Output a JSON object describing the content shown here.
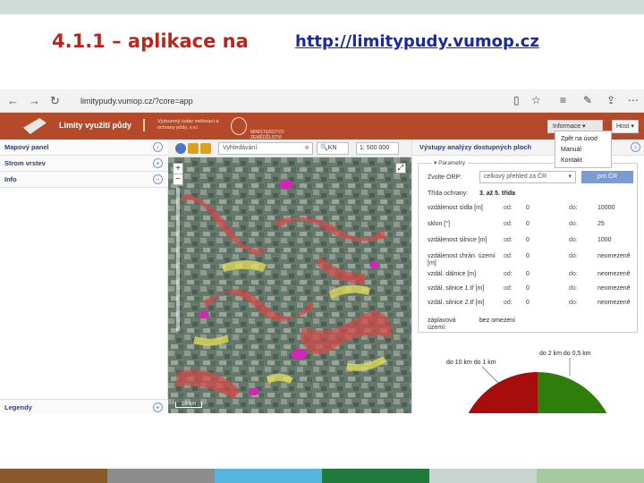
{
  "slide": {
    "title": "4.1.1 – aplikace na",
    "url": "http://limitypudy.vumop.cz"
  },
  "browser": {
    "address": "limitypudy.vumop.cz/?core=app"
  },
  "app": {
    "title": "Limity využití půdy",
    "institute": "Výzkumný ústav meliorací a ochrany půdy, v.v.i.",
    "ministry": "MINISTERSTVO ZEMĚDĚLSTVÍ",
    "info_button": "Informace",
    "host_button": "Host",
    "info_menu": [
      "Zpět na úvod",
      "Manuál",
      "Kontakt"
    ]
  },
  "sidebar": {
    "items": [
      {
        "label": "Mapový panel"
      },
      {
        "label": "Strom vrstev"
      },
      {
        "label": "Info"
      }
    ],
    "legend": "Legendy"
  },
  "toolbar": {
    "search_placeholder": "Vyhledávání",
    "kn_select": "KN",
    "scale": "1: 500 000"
  },
  "map": {
    "scalebar": "10 km"
  },
  "panel": {
    "title": "Výstupy analýzy dostupných ploch",
    "params_legend": "Parametry",
    "orp_label": "Zvolte ORP:",
    "orp_value": "celkový přehled za ČR",
    "orp_button": "pro ČR",
    "class_label": "Třída ochrany:",
    "class_value": "3. až 5. třída",
    "od_label": "od:",
    "do_label": "do:",
    "rows": [
      {
        "name": "vzdálenost sídla [m]",
        "from": "0",
        "to": "10000"
      },
      {
        "name": "sklon [°]",
        "from": "0",
        "to": "25"
      },
      {
        "name": "vzdálenost silnice [m]",
        "from": "0",
        "to": "1000"
      },
      {
        "name": "vzdálenost chrán. území [m]",
        "from": "0",
        "to": "neomezeně"
      },
      {
        "name": "vzdál. dálnice [m]",
        "from": "0",
        "to": "neomezeně"
      },
      {
        "name": "vzdál. silnice 1.tř [m]",
        "from": "0",
        "to": "neomezeně"
      },
      {
        "name": "vzdál. silnice 2.tř [m]",
        "from": "0",
        "to": "neomezeně"
      }
    ],
    "flood_label": "záplavová území:",
    "flood_value": "bez omezení"
  },
  "chart_data": {
    "type": "pie",
    "labels": [
      "do 10 km do 1 km",
      "do 2 km do 0,5 km"
    ],
    "colors": [
      "#a80d0d",
      "#2f7d0a",
      "#c9e07a"
    ]
  },
  "footer_colors": [
    "#8a5a2b",
    "#8d8d8d",
    "#57b5dd",
    "#1f7a3b",
    "#c9d3d0",
    "#a6c9a0"
  ]
}
